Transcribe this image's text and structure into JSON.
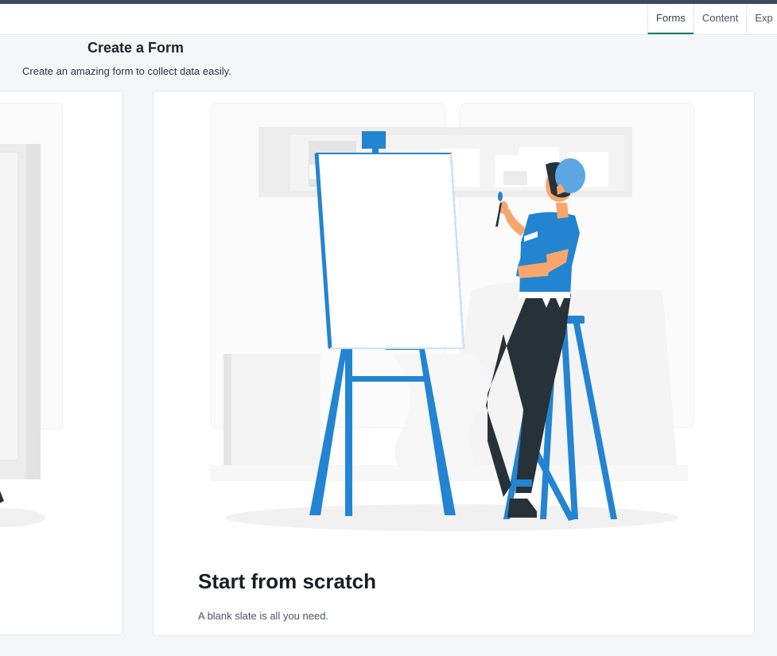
{
  "nav": {
    "tabs": [
      {
        "label": "Forms",
        "active": true
      },
      {
        "label": "Content",
        "active": false
      },
      {
        "label": "Exp",
        "active": false
      }
    ]
  },
  "page": {
    "title": "Create a Form",
    "subtitle": "Create an amazing form to collect data easily."
  },
  "cards": {
    "scratch": {
      "title": "Start from scratch",
      "description": "A blank slate is all you need."
    }
  },
  "colors": {
    "accent": "#2384d1",
    "underline": "#0f7a6b",
    "dark": "#263238",
    "skin": "#f9a66d"
  }
}
